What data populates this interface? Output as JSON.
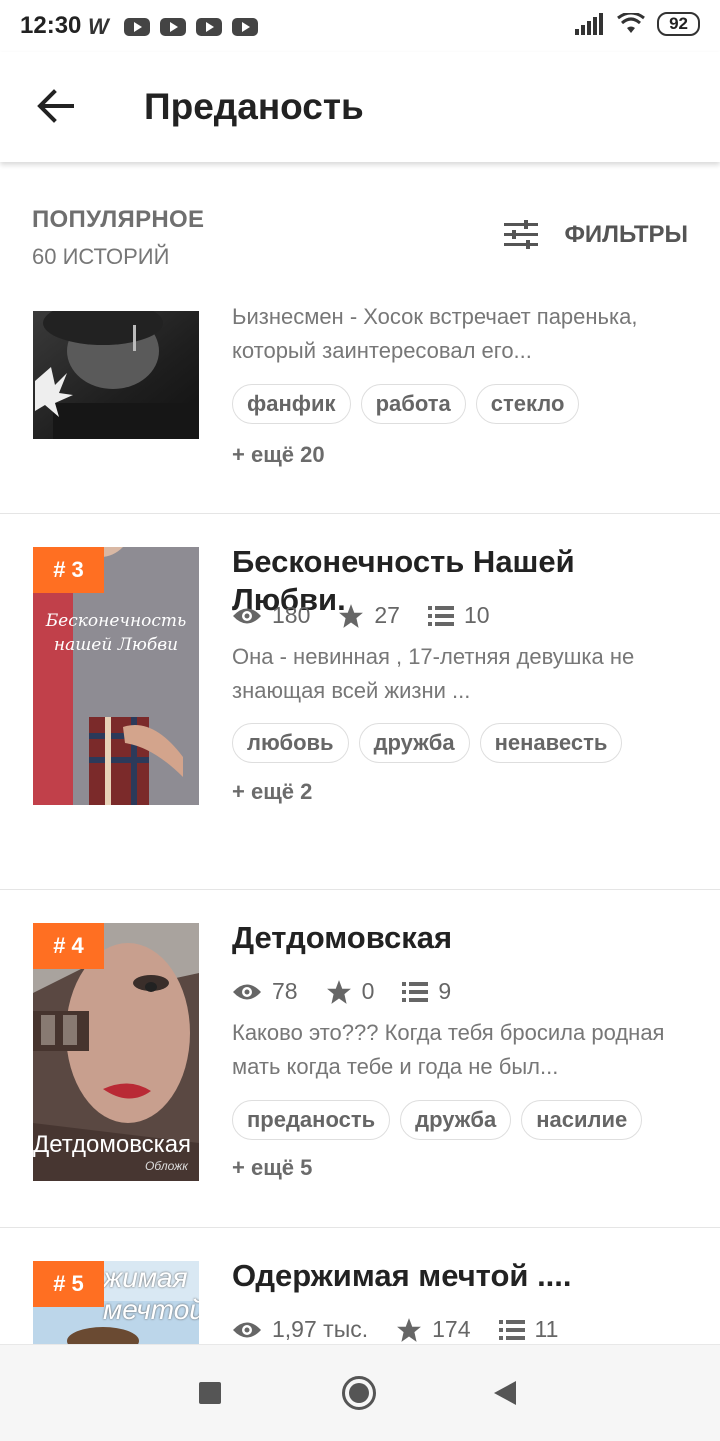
{
  "status_bar": {
    "time": "12:30",
    "notif_letter": "W",
    "battery": "92"
  },
  "app_bar": {
    "title": "Преданость"
  },
  "section": {
    "title": "ПОПУЛЯРНОЕ",
    "count": "60 ИСТОРИЙ",
    "filters_label": "ФИЛЬТРЫ"
  },
  "stories": [
    {
      "description": "Ьизнесмен - Хосок встречает паренька, который заинтересовал его...",
      "tags": [
        "фанфик",
        "работа",
        "стекло"
      ],
      "more": "+ ещё 20"
    },
    {
      "rank": "# 3",
      "title": "Бесконечность Нашей Любви.",
      "views": "180",
      "stars": "27",
      "parts": "10",
      "description": "Она - невинная , 17-летняя девушка не знающая всей жизни ...",
      "tags": [
        "любовь",
        "дружба",
        "ненавесть"
      ],
      "more": "+ ещё 2",
      "cover_text": "Бесконечность нашей Любви"
    },
    {
      "rank": "# 4",
      "title": "Детдомовская",
      "views": "78",
      "stars": "0",
      "parts": "9",
      "description": "Каково это??? Когда тебя бросила родная мать когда тебе и года не был...",
      "tags": [
        "преданость",
        "дружба",
        "насилие"
      ],
      "more": "+ ещё 5",
      "cover_text": "Детдомовская",
      "cover_sub": "Обложк"
    },
    {
      "rank": "# 5",
      "title": "Одержимая мечтой ....",
      "views": "1,97 тыс.",
      "stars": "174",
      "parts": "11",
      "cover_text": "мечтой",
      "cover_text2": "жимая"
    }
  ]
}
